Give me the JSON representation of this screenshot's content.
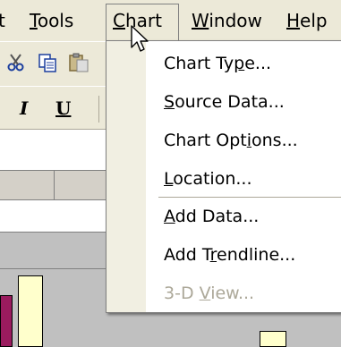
{
  "menubar": {
    "items": [
      {
        "text": "t"
      },
      {
        "pre": "",
        "acc": "T",
        "post": "ools"
      },
      {
        "pre": "",
        "acc": "C",
        "post": "hart"
      },
      {
        "pre": "",
        "acc": "W",
        "post": "indow"
      },
      {
        "pre": "",
        "acc": "H",
        "post": "elp"
      }
    ]
  },
  "toolbar": {
    "icons": [
      "cut-icon",
      "copy-icon",
      "paste-icon",
      "italic-icon",
      "underline-icon"
    ],
    "italic_label": "I",
    "underline_label": "U"
  },
  "chart_menu": {
    "items": [
      {
        "pre": "Chart Ty",
        "acc": "p",
        "post": "e...",
        "enabled": true
      },
      {
        "pre": "",
        "acc": "S",
        "post": "ource Data...",
        "enabled": true
      },
      {
        "pre": "Chart Opt",
        "acc": "i",
        "post": "ons...",
        "enabled": true
      },
      {
        "pre": "",
        "acc": "L",
        "post": "ocation...",
        "enabled": true
      },
      {
        "pre": "",
        "acc": "A",
        "post": "dd Data...",
        "enabled": true
      },
      {
        "pre": "Add T",
        "acc": "r",
        "post": "endline...",
        "enabled": true
      },
      {
        "pre": "3-D ",
        "acc": "V",
        "post": "iew...",
        "enabled": false
      }
    ]
  },
  "colors": {
    "chrome": "#ece9d8",
    "menu_bg": "#ffffff",
    "disabled_text": "#aca899",
    "bar_purple": "#9a1b5e",
    "bar_yellow": "#ffffcc"
  }
}
